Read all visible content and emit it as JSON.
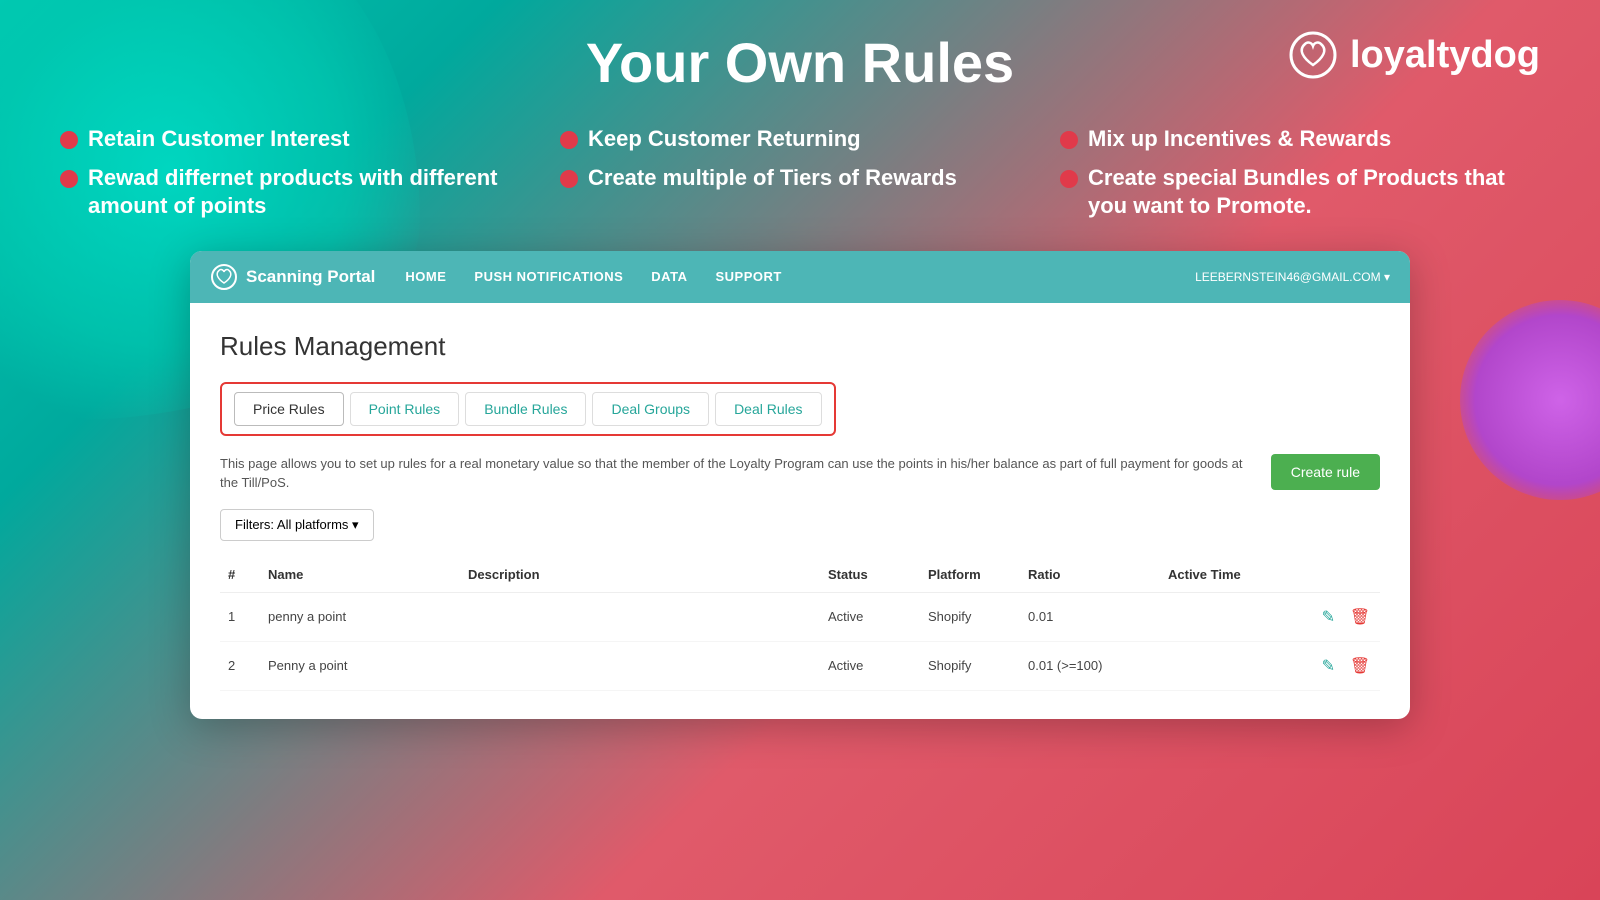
{
  "background": {
    "gradient": "linear-gradient(135deg, #00c9b1, #d94458)"
  },
  "logo": {
    "text": "loyaltydog",
    "icon_symbol": "♡"
  },
  "header": {
    "title": "Your Own Rules"
  },
  "features": [
    {
      "id": "feat1",
      "text": "Retain Customer Interest"
    },
    {
      "id": "feat2",
      "text": "Keep Customer Returning"
    },
    {
      "id": "feat3",
      "text": "Mix up Incentives & Rewards"
    },
    {
      "id": "feat4",
      "text": "Rewad differnet products with different amount of points"
    },
    {
      "id": "feat5",
      "text": "Create multiple of Tiers of Rewards"
    },
    {
      "id": "feat6",
      "text": "Create special Bundles of Products that you want to Promote."
    }
  ],
  "navbar": {
    "brand": "Scanning Portal",
    "links": [
      {
        "id": "home",
        "label": "HOME"
      },
      {
        "id": "push",
        "label": "PUSH NOTIFICATIONS"
      },
      {
        "id": "data",
        "label": "DATA"
      },
      {
        "id": "support",
        "label": "SUPPORT"
      }
    ],
    "user": "LEEBERNSTEIN46@GMAIL.COM ▾"
  },
  "main": {
    "page_heading": "Rules Management",
    "tabs": [
      {
        "id": "price-rules",
        "label": "Price Rules",
        "active": true,
        "highlight": false
      },
      {
        "id": "point-rules",
        "label": "Point Rules",
        "active": false,
        "highlight": true
      },
      {
        "id": "bundle-rules",
        "label": "Bundle Rules",
        "active": false,
        "highlight": true
      },
      {
        "id": "deal-groups",
        "label": "Deal Groups",
        "active": false,
        "highlight": true
      },
      {
        "id": "deal-rules",
        "label": "Deal Rules",
        "active": false,
        "highlight": true
      }
    ],
    "description": "This page allows you to set up rules for a real monetary value so that the member of the Loyalty Program can use the points in his/her balance as part of full payment for goods at the Till/PoS.",
    "create_rule_label": "Create rule",
    "filter_label": "Filters: All platforms ▾",
    "table": {
      "columns": [
        {
          "id": "num",
          "label": "#"
        },
        {
          "id": "name",
          "label": "Name"
        },
        {
          "id": "description",
          "label": "Description"
        },
        {
          "id": "status",
          "label": "Status"
        },
        {
          "id": "platform",
          "label": "Platform"
        },
        {
          "id": "ratio",
          "label": "Ratio"
        },
        {
          "id": "active_time",
          "label": "Active Time"
        },
        {
          "id": "actions",
          "label": ""
        }
      ],
      "rows": [
        {
          "num": "1",
          "name": "penny a point",
          "description": "",
          "status": "Active",
          "platform": "Shopify",
          "ratio": "0.01",
          "active_time": ""
        },
        {
          "num": "2",
          "name": "Penny a point",
          "description": "",
          "status": "Active",
          "platform": "Shopify",
          "ratio": "0.01 (>=100)",
          "active_time": ""
        }
      ]
    }
  }
}
